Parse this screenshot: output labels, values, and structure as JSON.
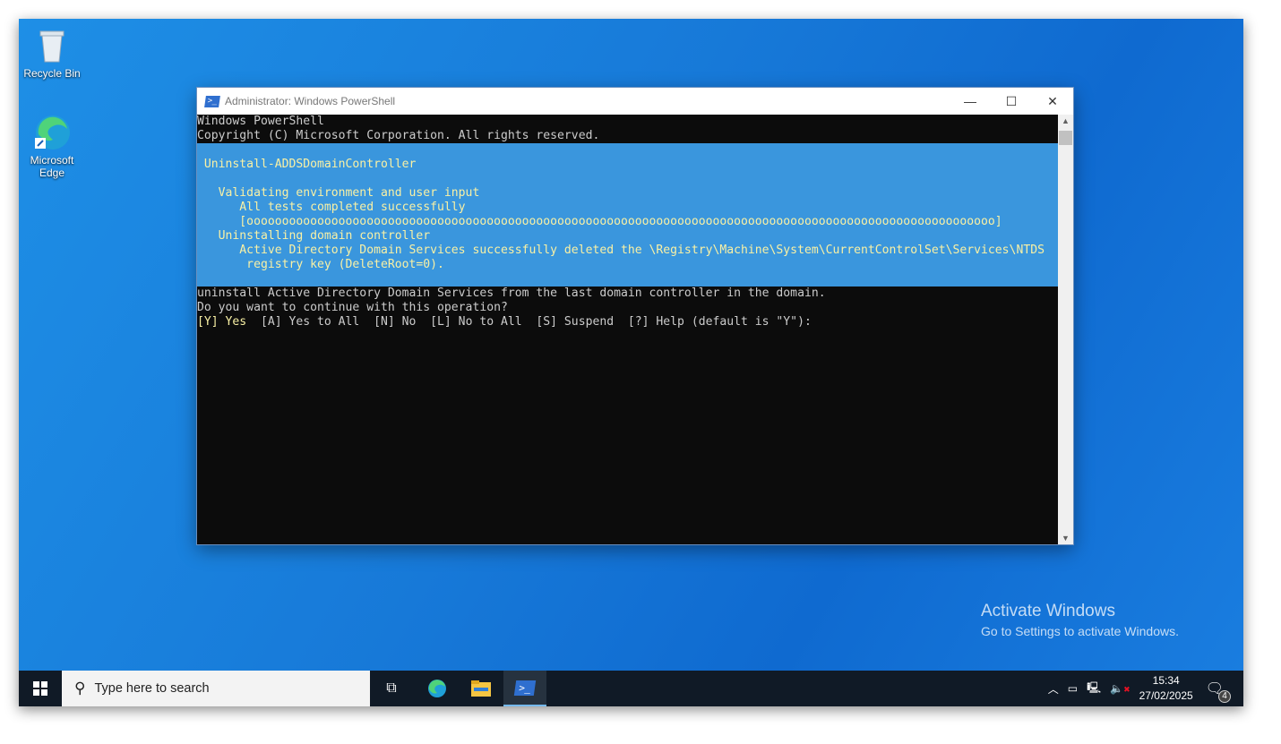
{
  "desktop": {
    "icons": [
      {
        "label": "Recycle Bin"
      },
      {
        "label": "Microsoft Edge"
      }
    ]
  },
  "window": {
    "title": "Administrator: Windows PowerShell",
    "controls": {
      "minimize": "—",
      "maximize": "☐",
      "close": "✕"
    }
  },
  "console": {
    "lines": [
      "Windows PowerShell",
      "Copyright (C) Microsoft Corporation. All rights reserved."
    ],
    "progress": {
      "activity": " Uninstall-ADDSDomainController",
      "op1": "   Validating environment and user input",
      "op1_status": "      All tests completed successfully",
      "op1_bar": "      [oooooooooooooooooooooooooooooooooooooooooooooooooooooooooooooooooooooooooooooooooooooooooooooooooooooooooo]",
      "op2": "   Uninstalling domain controller",
      "op2_status": "      Active Directory Domain Services successfully deleted the \\Registry\\Machine\\System\\CurrentControlSet\\Services\\NTDS",
      "op2_status2": "       registry key (DeleteRoot=0).",
      "percent_complete": 100
    },
    "prompt_lines": [
      "uninstall Active Directory Domain Services from the last domain controller in the domain.",
      "Do you want to continue with this operation?"
    ],
    "choice_default": "[Y] Yes",
    "choice_rest": "  [A] Yes to All  [N] No  [L] No to All  [S] Suspend  [?] Help (default is \"Y\"):"
  },
  "watermark": {
    "title": "Activate Windows",
    "subtitle": "Go to Settings to activate Windows."
  },
  "taskbar": {
    "search_placeholder": "Type here to search",
    "time": "15:34",
    "date": "27/02/2025",
    "notifications": "4"
  }
}
